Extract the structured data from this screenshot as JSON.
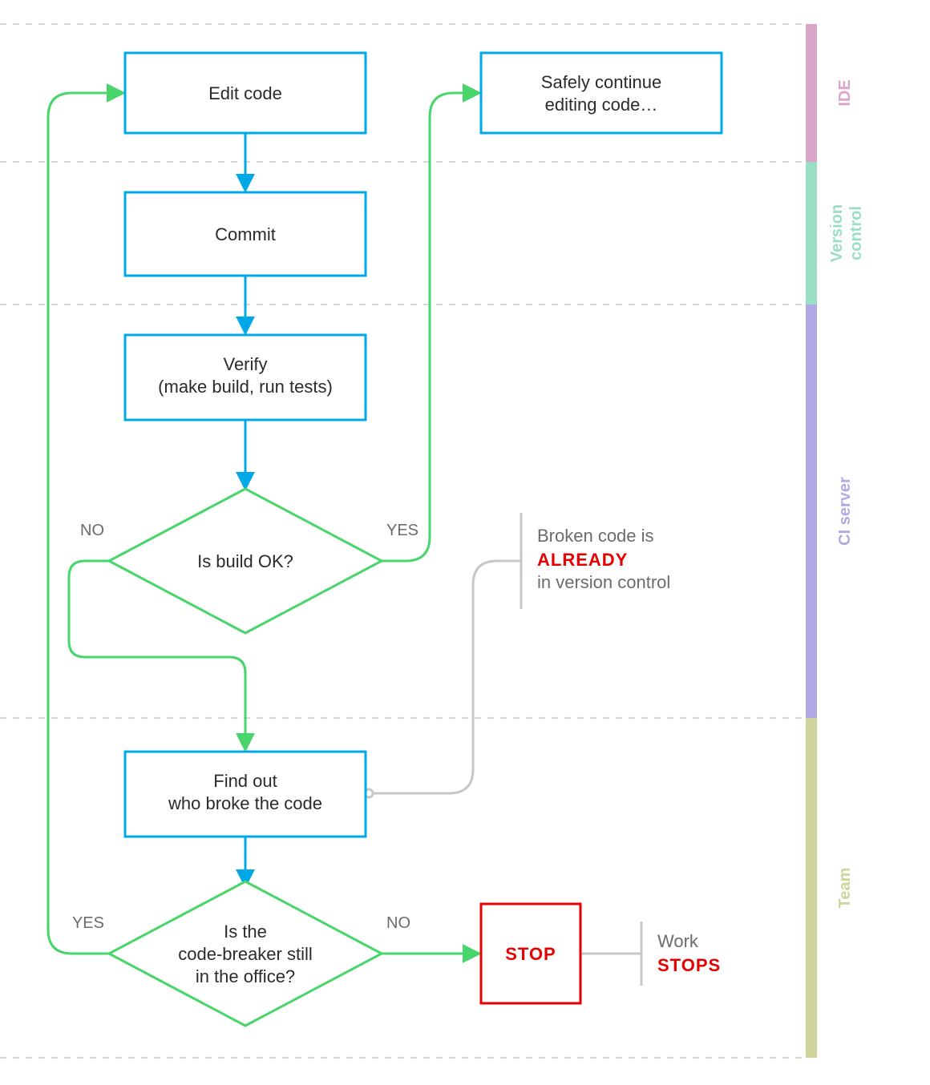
{
  "lanes": {
    "ide": "IDE",
    "vcs_line1": "Version",
    "vcs_line2": "control",
    "ci": "CI server",
    "team": "Team"
  },
  "nodes": {
    "edit_code": "Edit code",
    "safely_line1": "Safely continue",
    "safely_line2": "editing code…",
    "commit": "Commit",
    "verify_line1": "Verify",
    "verify_line2": "(make build, run tests)",
    "build_ok": "Is build OK?",
    "find_out_line1": "Find out",
    "find_out_line2": "who broke the code",
    "inoffice_line1": "Is the",
    "inoffice_line2": "code-breaker still",
    "inoffice_line3": "in the office?",
    "stop": "STOP"
  },
  "edges": {
    "no": "NO",
    "yes": "YES"
  },
  "annotations": {
    "broken_line1": "Broken code is",
    "broken_word": "ALREADY",
    "broken_line3": "in version control",
    "work": "Work",
    "stops": "STOPS"
  },
  "colors": {
    "blue": "#00a8e8",
    "green": "#48d66a",
    "red": "#e60000",
    "gray": "#c7c7c7",
    "lane_ide": "#d9a6c9",
    "lane_vcs": "#9adfc4",
    "lane_ci": "#b3a8e6",
    "lane_team": "#cfd49a",
    "dash": "#d9d9d9",
    "text": "#2b2b2b",
    "muted": "#6b6b6b"
  }
}
